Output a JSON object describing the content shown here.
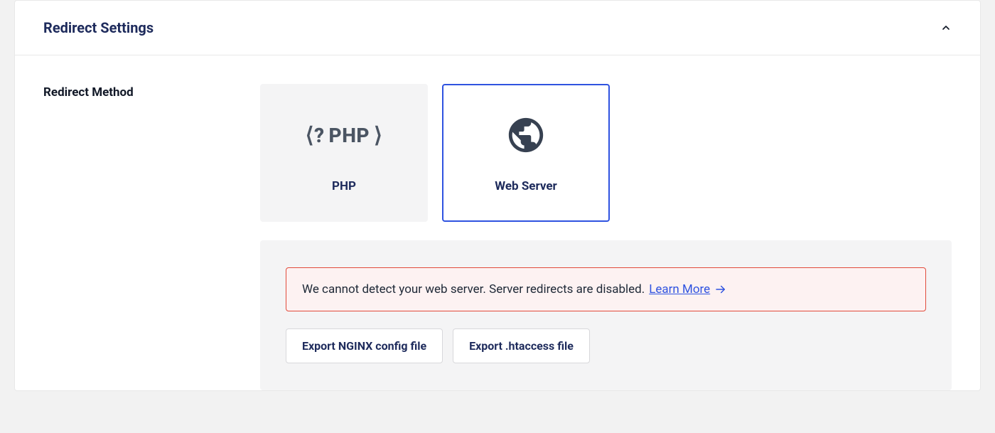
{
  "panel": {
    "title": "Redirect Settings"
  },
  "field": {
    "label": "Redirect Method"
  },
  "options": {
    "php": {
      "icon_label": "<? PHP >",
      "label": "PHP"
    },
    "webserver": {
      "icon_name": "globe-icon",
      "label": "Web Server"
    }
  },
  "alert": {
    "text": "We cannot detect your web server. Server redirects are disabled.",
    "link_text": "Learn More"
  },
  "buttons": {
    "export_nginx": "Export NGINX config file",
    "export_htaccess": "Export .htaccess file"
  }
}
